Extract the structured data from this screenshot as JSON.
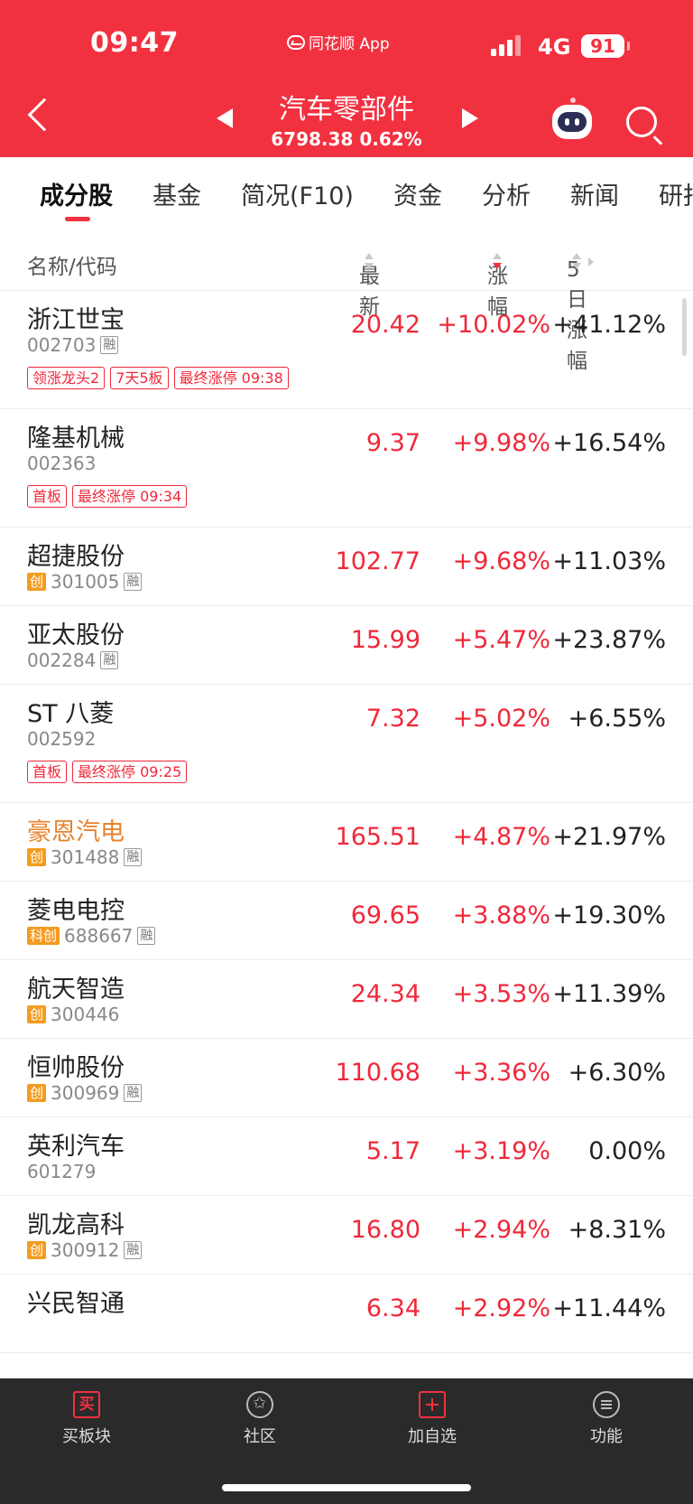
{
  "status_bar": {
    "time": "09:47",
    "app": "同花顺 App",
    "network": "4G",
    "battery": "91"
  },
  "header": {
    "title": "汽车零部件",
    "index_value": "6798.38",
    "index_change": "0.62%"
  },
  "tabs": [
    "成分股",
    "基金",
    "简况(F10)",
    "资金",
    "分析",
    "新闻",
    "研报"
  ],
  "columns": {
    "name": "名称/代码",
    "latest": "最新",
    "change": "涨幅",
    "change5": "5日涨幅"
  },
  "stocks": [
    {
      "name": "浙江世宝",
      "code": "002703",
      "badge": "",
      "rong": "融",
      "price": "20.42",
      "change": "+10.02%",
      "change5": "+41.12%",
      "tags": [
        "领涨龙头2",
        "7天5板",
        "最终涨停 09:38"
      ]
    },
    {
      "name": "隆基机械",
      "code": "002363",
      "badge": "",
      "rong": "",
      "price": "9.37",
      "change": "+9.98%",
      "change5": "+16.54%",
      "tags": [
        "首板",
        "最终涨停 09:34"
      ]
    },
    {
      "name": "超捷股份",
      "code": "301005",
      "badge": "创",
      "rong": "融",
      "price": "102.77",
      "change": "+9.68%",
      "change5": "+11.03%",
      "tags": []
    },
    {
      "name": "亚太股份",
      "code": "002284",
      "badge": "",
      "rong": "融",
      "price": "15.99",
      "change": "+5.47%",
      "change5": "+23.87%",
      "tags": []
    },
    {
      "name": "ST 八菱",
      "code": "002592",
      "badge": "",
      "rong": "",
      "price": "7.32",
      "change": "+5.02%",
      "change5": "+6.55%",
      "tags": [
        "首板",
        "最终涨停 09:25"
      ]
    },
    {
      "name": "豪恩汽电",
      "code": "301488",
      "badge": "创",
      "rong": "融",
      "price": "165.51",
      "change": "+4.87%",
      "change5": "+21.97%",
      "tags": [],
      "highlight": true
    },
    {
      "name": "菱电电控",
      "code": "688667",
      "badge": "科创",
      "rong": "融",
      "price": "69.65",
      "change": "+3.88%",
      "change5": "+19.30%",
      "tags": []
    },
    {
      "name": "航天智造",
      "code": "300446",
      "badge": "创",
      "rong": "",
      "price": "24.34",
      "change": "+3.53%",
      "change5": "+11.39%",
      "tags": []
    },
    {
      "name": "恒帅股份",
      "code": "300969",
      "badge": "创",
      "rong": "融",
      "price": "110.68",
      "change": "+3.36%",
      "change5": "+6.30%",
      "tags": []
    },
    {
      "name": "英利汽车",
      "code": "601279",
      "badge": "",
      "rong": "",
      "price": "5.17",
      "change": "+3.19%",
      "change5": "0.00%",
      "tags": []
    },
    {
      "name": "凯龙高科",
      "code": "300912",
      "badge": "创",
      "rong": "融",
      "price": "16.80",
      "change": "+2.94%",
      "change5": "+8.31%",
      "tags": []
    },
    {
      "name": "兴民智通",
      "code": "",
      "badge": "",
      "rong": "",
      "price": "6.34",
      "change": "+2.92%",
      "change5": "+11.44%",
      "tags": []
    }
  ],
  "bottom_nav": [
    {
      "label": "买板块",
      "icon": "buy-icon",
      "icon_text": "买"
    },
    {
      "label": "社区",
      "icon": "community-icon"
    },
    {
      "label": "加自选",
      "icon": "add-watchlist-icon"
    },
    {
      "label": "功能",
      "icon": "menu-icon"
    }
  ],
  "colors": {
    "brand_red": "#f23140",
    "rise_red": "#f0283a",
    "chuang_orange": "#f39c20",
    "highlight_name": "#e8832c"
  }
}
